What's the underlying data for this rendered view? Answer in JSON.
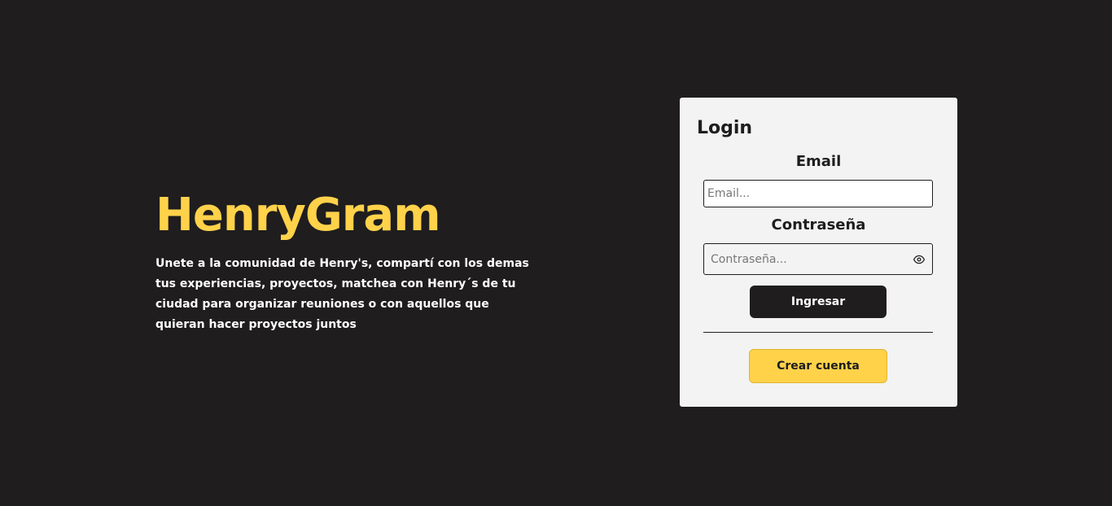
{
  "colors": {
    "background": "#1f1d1e",
    "accent": "#ffd24a",
    "card": "#f3f3f3"
  },
  "hero": {
    "title": "HenryGram",
    "tagline": "Unete a la comunidad de Henry's, compartí con los demas tus experiencias, proyectos, matchea con Henry´s de tu ciudad para organizar reuniones o con aquellos que quieran hacer proyectos juntos"
  },
  "login": {
    "title": "Login",
    "email_label": "Email",
    "email_placeholder": "Email...",
    "email_value": "",
    "password_label": "Contraseña",
    "password_placeholder": "Contraseña...",
    "password_value": "",
    "password_toggle_icon": "eye-icon",
    "submit_label": "Ingresar",
    "create_account_label": "Crear cuenta"
  }
}
